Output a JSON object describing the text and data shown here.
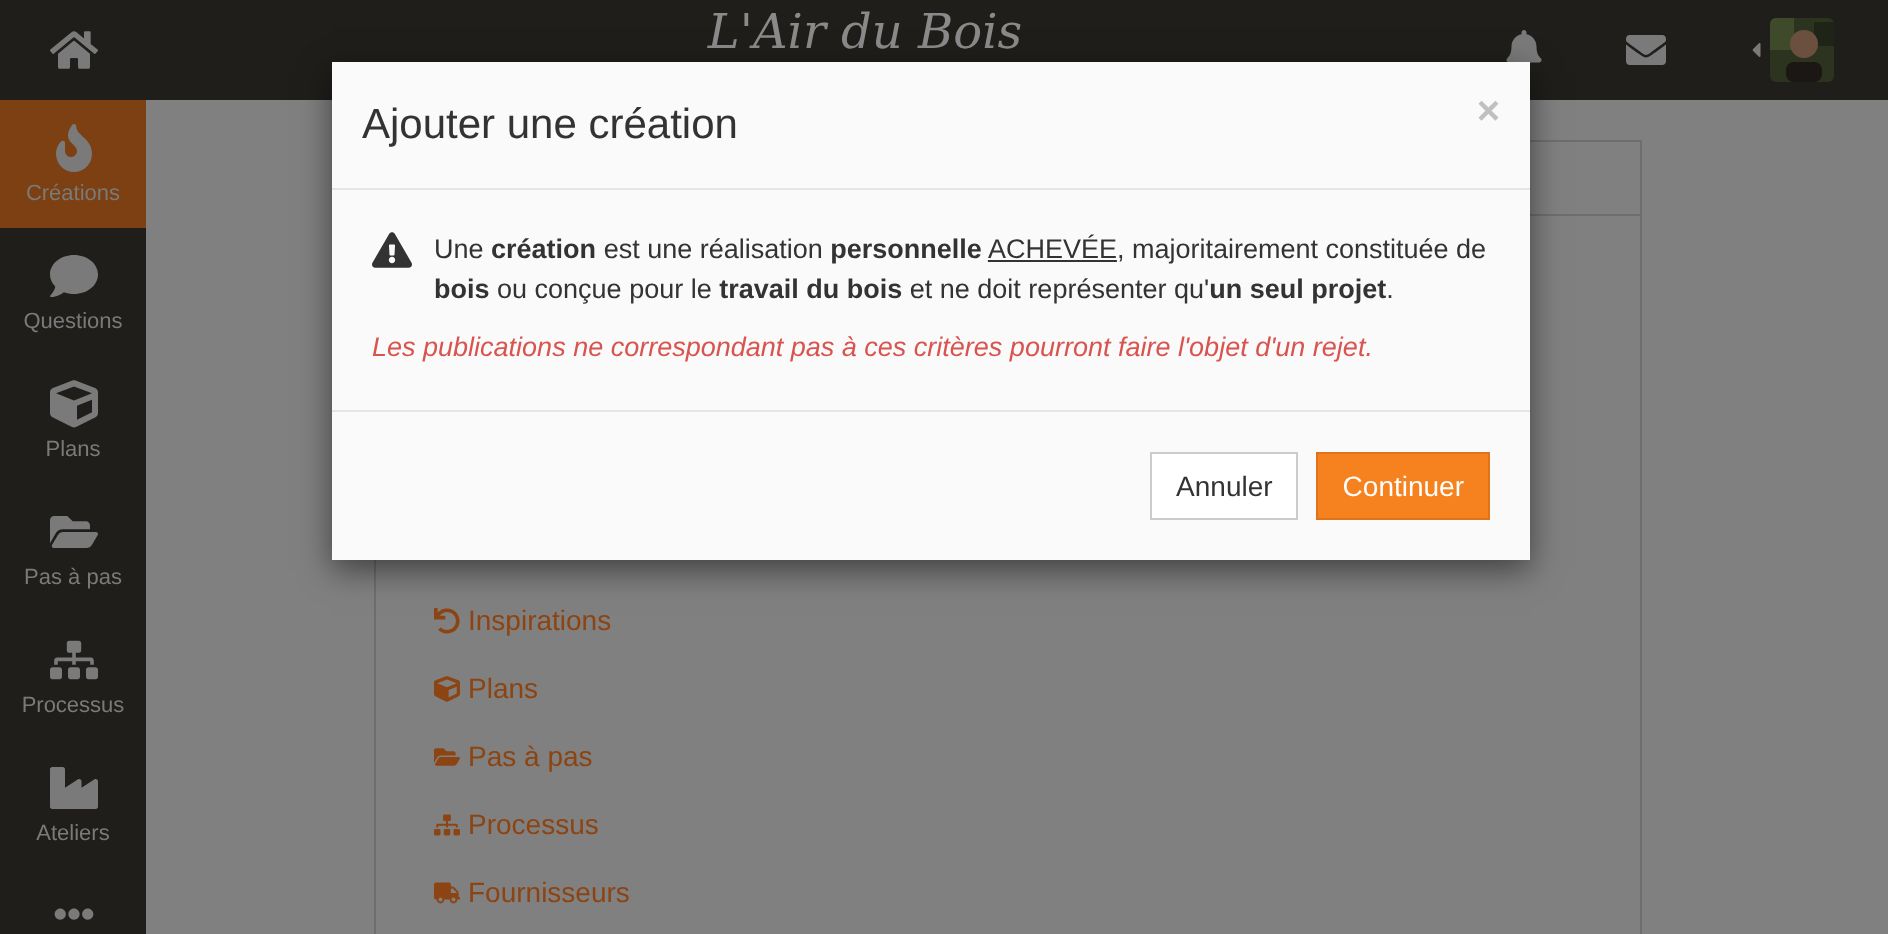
{
  "header": {
    "logo": "L'Air du Bois"
  },
  "sidebar": {
    "items": [
      {
        "label": "Créations",
        "kind": "flame",
        "selected": true
      },
      {
        "label": "Questions",
        "kind": "question",
        "selected": false
      },
      {
        "label": "Plans",
        "kind": "cube",
        "selected": false
      },
      {
        "label": "Pas à pas",
        "kind": "folder",
        "selected": false
      },
      {
        "label": "Processus",
        "kind": "sitemap",
        "selected": false
      },
      {
        "label": "Ateliers",
        "kind": "factory",
        "selected": false
      }
    ]
  },
  "panel": {
    "links": [
      {
        "label": "Inspirations",
        "kind": "undo"
      },
      {
        "label": "Plans",
        "kind": "cube"
      },
      {
        "label": "Pas à pas",
        "kind": "folder"
      },
      {
        "label": "Processus",
        "kind": "sitemap"
      },
      {
        "label": "Fournisseurs",
        "kind": "truck"
      }
    ]
  },
  "modal": {
    "title": "Ajouter une création",
    "close": "×",
    "message": [
      {
        "kind": "text",
        "text": "Une **création** est une réalisation **personnelle** "
      },
      {
        "kind": "underlined",
        "text": "ACHEVÉE"
      },
      {
        "kind": "text",
        "text": ", majoritairement constituée de **bois** ou conçue pour le **travail du bois** et ne doit représenter qu'**un seul projet**."
      }
    ],
    "warning": "Les publications ne correspondant pas à ces critères pourront faire l'objet d'un rejet.",
    "buttons": [
      {
        "label": "Annuler",
        "kind": "secondary"
      },
      {
        "label": "Continuer",
        "kind": "primary"
      }
    ]
  }
}
